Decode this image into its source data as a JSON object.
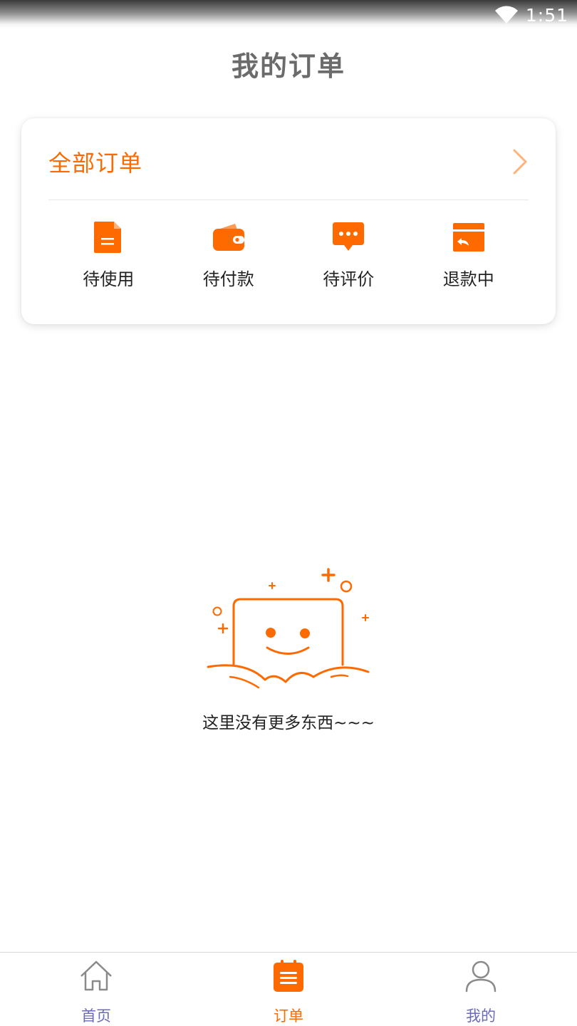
{
  "status_bar": {
    "time": "1:51",
    "wifi_icon": "wifi-icon"
  },
  "header": {
    "title": "我的订单"
  },
  "order_card": {
    "all_orders_label": "全部订单",
    "chevron_icon": "chevron-right-icon",
    "statuses": [
      {
        "label": "待使用",
        "icon": "document-icon"
      },
      {
        "label": "待付款",
        "icon": "wallet-icon"
      },
      {
        "label": "待评价",
        "icon": "chat-bubble-icon"
      },
      {
        "label": "退款中",
        "icon": "refund-card-icon"
      }
    ]
  },
  "empty_state": {
    "message": "这里没有更多东西~~~",
    "icon": "smiley-box-icon"
  },
  "bottom_nav": {
    "items": [
      {
        "label": "首页",
        "icon": "home-icon",
        "active": false
      },
      {
        "label": "订单",
        "icon": "order-list-icon",
        "active": true
      },
      {
        "label": "我的",
        "icon": "user-icon",
        "active": false
      }
    ]
  },
  "colors": {
    "accent": "#ff6a00",
    "nav_inactive": "#6b6bb8",
    "title": "#6b6b6b"
  }
}
